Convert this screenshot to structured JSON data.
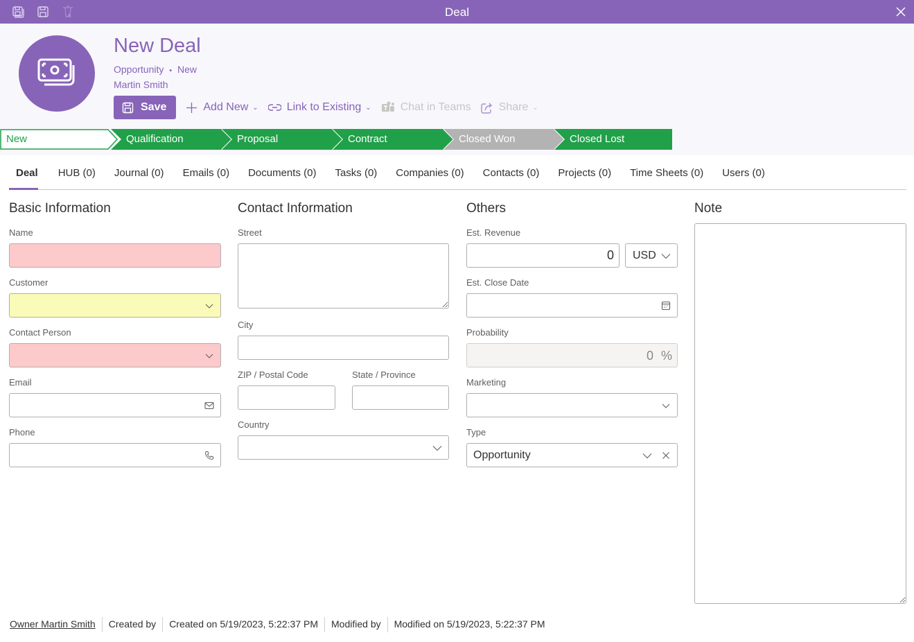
{
  "window": {
    "title": "Deal",
    "icons": [
      "save-close-icon",
      "save-icon",
      "delete-icon",
      "close-icon"
    ]
  },
  "colors": {
    "brand": "#8764b8",
    "stage_active": "#21a04a",
    "stage_disabled": "#b3b3b3",
    "required_error": "#fccaca",
    "required_warning": "#fafbb8"
  },
  "header": {
    "avatar_icon": "money-icon",
    "title": "New Deal",
    "subtitle_type": "Opportunity",
    "subtitle_separator": "•",
    "subtitle_status": "New",
    "owner": "Martin Smith"
  },
  "toolbar": {
    "save_label": "Save",
    "add_new_label": "Add New",
    "link_existing_label": "Link to Existing",
    "chat_teams_label": "Chat in Teams",
    "share_label": "Share"
  },
  "stages": [
    {
      "label": "New",
      "state": "current"
    },
    {
      "label": "Qualification",
      "state": "active"
    },
    {
      "label": "Proposal",
      "state": "active"
    },
    {
      "label": "Contract",
      "state": "active"
    },
    {
      "label": "Closed Won",
      "state": "disabled"
    },
    {
      "label": "Closed Lost",
      "state": "active"
    }
  ],
  "tabs": [
    {
      "label": "Deal",
      "active": true
    },
    {
      "label": "HUB (0)"
    },
    {
      "label": "Journal (0)"
    },
    {
      "label": "Emails (0)"
    },
    {
      "label": "Documents (0)"
    },
    {
      "label": "Tasks (0)"
    },
    {
      "label": "Companies (0)"
    },
    {
      "label": "Contacts (0)"
    },
    {
      "label": "Projects (0)"
    },
    {
      "label": "Time Sheets (0)"
    },
    {
      "label": "Users (0)"
    }
  ],
  "basic": {
    "title": "Basic Information",
    "name_label": "Name",
    "name_value": "",
    "customer_label": "Customer",
    "customer_value": "",
    "contact_label": "Contact Person",
    "contact_value": "",
    "email_label": "Email",
    "email_value": "",
    "phone_label": "Phone",
    "phone_value": ""
  },
  "contact": {
    "title": "Contact Information",
    "street_label": "Street",
    "street_value": "",
    "city_label": "City",
    "city_value": "",
    "zip_label": "ZIP / Postal Code",
    "zip_value": "",
    "state_label": "State / Province",
    "state_value": "",
    "country_label": "Country",
    "country_value": ""
  },
  "others": {
    "title": "Others",
    "revenue_label": "Est. Revenue",
    "revenue_value": "0",
    "currency": "USD",
    "close_date_label": "Est. Close Date",
    "close_date_value": "",
    "probability_label": "Probability",
    "probability_value": "0",
    "probability_unit": "%",
    "marketing_label": "Marketing",
    "marketing_value": "",
    "type_label": "Type",
    "type_value": "Opportunity"
  },
  "note": {
    "title": "Note",
    "value": ""
  },
  "footer": {
    "owner": "Owner Martin Smith",
    "created_by": "Created by",
    "created_on": "Created on 5/19/2023, 5:22:37 PM",
    "modified_by": "Modified by",
    "modified_on": "Modified on 5/19/2023, 5:22:37 PM"
  }
}
